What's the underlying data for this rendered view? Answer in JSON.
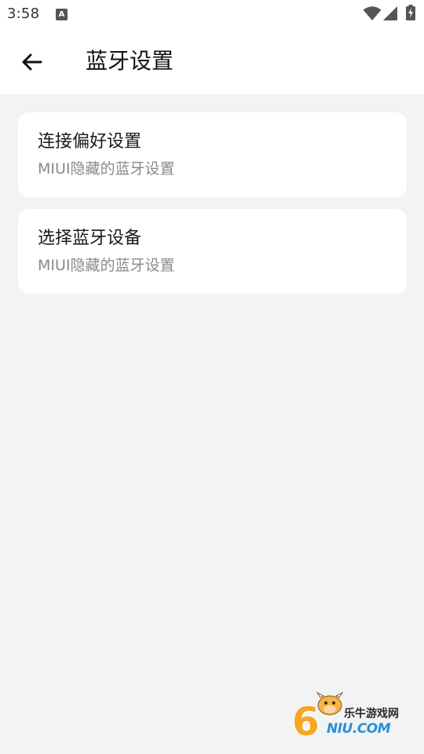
{
  "status_bar": {
    "time": "3:58",
    "notification_icon": "a-icon"
  },
  "app_bar": {
    "title": "蓝牙设置",
    "back_icon": "arrow-left-icon"
  },
  "settings": [
    {
      "title": "连接偏好设置",
      "subtitle": "MIUI隐藏的蓝牙设置"
    },
    {
      "title": "选择蓝牙设备",
      "subtitle": "MIUI隐藏的蓝牙设置"
    }
  ],
  "watermark": {
    "site_name": "乐牛游戏网",
    "url_text": "NIU.COM",
    "digit": "6"
  },
  "colors": {
    "background": "#f2f3f5",
    "card": "#ffffff",
    "subtitle": "#8a8a8a",
    "watermark_blue": "#2b8fd6",
    "watermark_orange": "#f5a623"
  }
}
